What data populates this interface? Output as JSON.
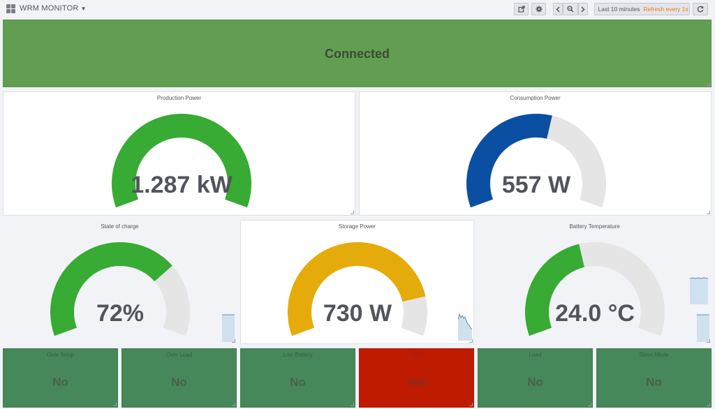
{
  "header": {
    "dashboard_title": "WRM MONITOR",
    "time_range": "Last 10 minutes",
    "refresh": "Refresh every 1s"
  },
  "status": {
    "value": "Connected",
    "color": "#629e51"
  },
  "gauges": {
    "production": {
      "title": "Production Power",
      "value": "1.287 kW",
      "fraction": 1.0,
      "color": "#37ab33"
    },
    "consumption": {
      "title": "Consumption Power",
      "value": "557 W",
      "fraction": 0.56,
      "color": "#0b4fa3"
    },
    "soc": {
      "title": "State of charge",
      "value": "72%",
      "fraction": 0.72,
      "color": "#37ab33"
    },
    "storage": {
      "title": "Storage Power",
      "value": "730 W",
      "fraction": 0.85,
      "color": "#e5ab0a"
    },
    "battery_temp": {
      "title": "Battery Temperature",
      "value": "24.0 °C",
      "fraction": 0.44,
      "color": "#37ab33"
    }
  },
  "flags": [
    {
      "title": "Over Temp",
      "value": "No",
      "color": "#46885a"
    },
    {
      "title": "Over Load",
      "value": "No",
      "color": "#46885a"
    },
    {
      "title": "Low Battery",
      "value": "No",
      "color": "#46885a"
    },
    {
      "title": "Grid",
      "value": "Yes",
      "color": "#bf1b00"
    },
    {
      "title": "Load",
      "value": "No",
      "color": "#46885a"
    },
    {
      "title": "Slave Mode",
      "value": "No",
      "color": "#46885a"
    }
  ],
  "icons": {
    "logo": "dashboard-grid-icon",
    "share": "share-icon",
    "settings": "gear-icon",
    "back": "chevron-left-icon",
    "zoom": "zoom-out-icon",
    "forward": "chevron-right-icon",
    "clock": "clock-icon",
    "refresh": "refresh-icon"
  },
  "colors": {
    "background": "#f2f3f7",
    "gauge_track": "#e5e5e5",
    "refresh_text": "#eb7b18"
  }
}
